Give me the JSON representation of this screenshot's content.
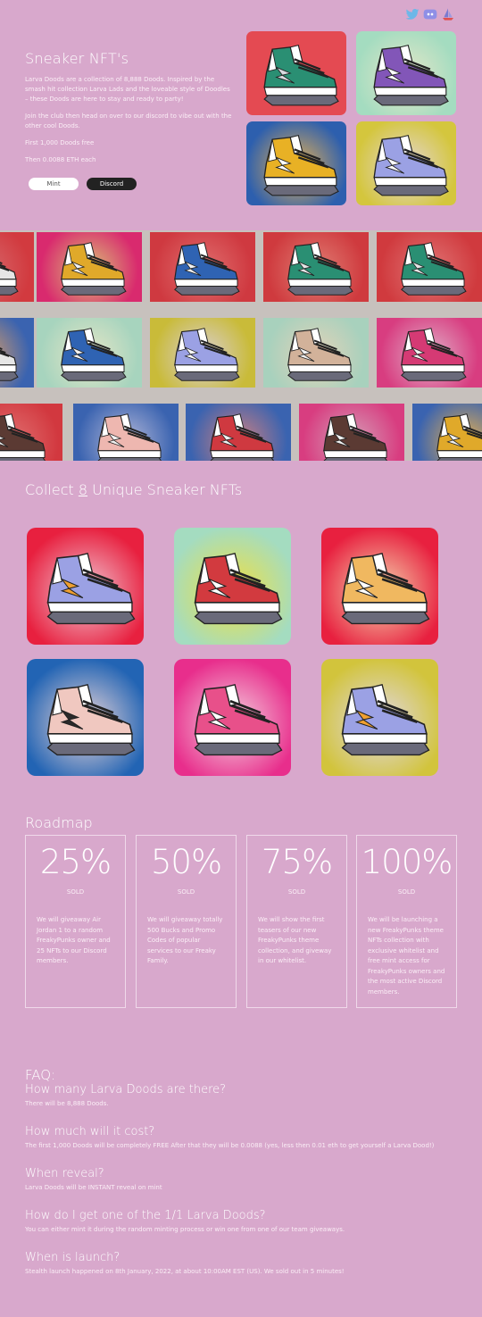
{
  "social": [
    {
      "name": "twitter-icon",
      "color": "#6db7e8"
    },
    {
      "name": "discord-icon",
      "color": "#8f8fe6"
    },
    {
      "name": "opensea-icon",
      "color": "#7a7ad0"
    }
  ],
  "hero": {
    "title": "Sneaker NFT's",
    "p1": "Larva Doods are a collection of 8,888 Doods. Inspired by the smash hit collection Larva Lads and the loveable style of Doodles – these Doods are here to stay and ready to party!",
    "p2": "Join the club then head on over to our discord to vibe out with the other cool Doods.",
    "p3": "First 1,000 Doods free",
    "p4": "Then 0.0088 ETH each",
    "mint_label": "Mint",
    "discord_label": "Discord",
    "tiles": [
      {
        "bg": "#e44a52",
        "glow": "#e44a52",
        "upper": "#2a8f73",
        "accent": "#d9dce0"
      },
      {
        "bg": "#a4dcc0",
        "glow": "#e7e7c8",
        "upper": "#8256b8",
        "accent": "#ffffff"
      },
      {
        "bg": "#2d5fae",
        "glow": "#e8b252",
        "upper": "#e8b125",
        "accent": "#ffffff"
      },
      {
        "bg": "#d4c63d",
        "glow": "#e3d6d8",
        "upper": "#9ba1e4",
        "accent": "#ffffff"
      }
    ]
  },
  "banner_tiles": [
    {
      "bg": "#d23a3f",
      "glow": "#d66b6e",
      "upper": "#e6e6e6",
      "accent": "#d23a3f"
    },
    {
      "bg": "#d92a6e",
      "glow": "#d9c276",
      "upper": "#e0a92a",
      "accent": "#f2f2f2"
    },
    {
      "bg": "#cf3940",
      "glow": "#e06f6f",
      "upper": "#2f63b3",
      "accent": "#f2f2f2"
    },
    {
      "bg": "#cf3a3e",
      "glow": "#e07e74",
      "upper": "#2a8f73",
      "accent": "#e6e6e6"
    },
    {
      "bg": "#d03a3e",
      "glow": "#e07575",
      "upper": "#2a8f73",
      "accent": "#e6e6e6"
    },
    {
      "bg": "#3a63b0",
      "glow": "#e2a064",
      "upper": "#e6e6e6",
      "accent": "#3a63b0"
    },
    {
      "bg": "#a7d4be",
      "glow": "#e6e6c6",
      "upper": "#2f63b3",
      "accent": "#f2f2f2"
    },
    {
      "bg": "#c9bb39",
      "glow": "#d9cfd6",
      "upper": "#9ba1e4",
      "accent": "#ffffff"
    },
    {
      "bg": "#a8d1bd",
      "glow": "#e4d2b8",
      "upper": "#d2b29a",
      "accent": "#f2f2f2"
    },
    {
      "bg": "#d83d80",
      "glow": "#e0b0c8",
      "upper": "#d53a74",
      "accent": "#f2f2f2"
    },
    {
      "bg": "#d2383f",
      "glow": "#e07070",
      "upper": "#5b3a33",
      "accent": "#f2f2f2"
    },
    {
      "bg": "#3a63b0",
      "glow": "#b4b8d8",
      "upper": "#eeb7b0",
      "accent": "#f2f2f2"
    },
    {
      "bg": "#3a63b0",
      "glow": "#d08080",
      "upper": "#cf3940",
      "accent": "#f2f2f2"
    },
    {
      "bg": "#d83d80",
      "glow": "#d4a0b8",
      "upper": "#5b3a33",
      "accent": "#f2f2f2"
    },
    {
      "bg": "#3a63b0",
      "glow": "#e6b050",
      "upper": "#e0a92a",
      "accent": "#f2f2f2"
    }
  ],
  "collect": {
    "prefix": "Collect ",
    "count": "8",
    "suffix": " Unique Sneaker NFTs",
    "cards": [
      {
        "bg": "#e8203f",
        "glow": "#f0c8d4",
        "upper": "#9ba1e4",
        "accent": "#f0a030"
      },
      {
        "bg": "#a4dcc0",
        "glow": "#f0e040",
        "upper": "#d23a3f",
        "accent": "#ffffff"
      },
      {
        "bg": "#e8203f",
        "glow": "#f4d8b0",
        "upper": "#f0b860",
        "accent": "#ffffff"
      },
      {
        "bg": "#2264b4",
        "glow": "#f0d8d8",
        "upper": "#f0c8c0",
        "accent": "#2a2a2a"
      },
      {
        "bg": "#e82e8c",
        "glow": "#f4d4e0",
        "upper": "#e8508a",
        "accent": "#ffffff"
      },
      {
        "bg": "#d2c43c",
        "glow": "#e0d8e8",
        "upper": "#9ba1e4",
        "accent": "#f0a030"
      }
    ]
  },
  "roadmap": {
    "title": "Roadmap",
    "items": [
      {
        "pct": "25%",
        "sold": "SOLD",
        "text": "We will giveaway Air Jordan 1 to a random FreakyPunks owner and 25 NFTs to our Discord members."
      },
      {
        "pct": "50%",
        "sold": "SOLD",
        "text": "We will giveaway totally 500 Bucks and Promo Codes of popular services to our Freaky Family."
      },
      {
        "pct": "75%",
        "sold": "SOLD",
        "text": "We will show the first teasers of our new FreakyPunks theme collection, and giveway in our whitelist."
      },
      {
        "pct": "100%",
        "sold": "SOLD",
        "text": "We will be launching a new FreakyPunks theme NFTs collection with exclusive whitelist and free mint access for FreakyPunks owners and the most active Discord members."
      }
    ]
  },
  "faq": {
    "title": "FAQ:",
    "items": [
      {
        "q": "How many Larva Doods are there?",
        "a": "There will be 8,888 Doods."
      },
      {
        "q": "How much will it cost?",
        "a": "The first 1,000 Doods will be completely FREE After that they will be 0.0088 (yes, less then 0.01 eth to get yourself a Larva Dood!)"
      },
      {
        "q": "When reveal?",
        "a": "Larva Doods will be INSTANT reveal on mint"
      },
      {
        "q": "How do I get one of the 1/1 Larva Doods?",
        "a": "You can either mint it during the random minting process or win one from one of our team giveaways."
      },
      {
        "q": "When is launch?",
        "a": "Stealth launch happened on 8th January, 2022, at about 10:00AM EST (US). We sold out in 5 minutes!"
      }
    ]
  }
}
